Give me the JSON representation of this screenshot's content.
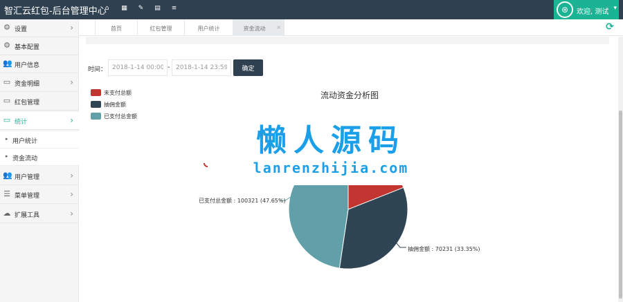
{
  "header": {
    "title": "智汇云红包-后台管理中心",
    "quick_buttons": [
      {
        "icon": "home-icon",
        "glyph": "⌂",
        "color": "#f8ac59"
      },
      {
        "icon": "grid-icon",
        "glyph": "▦",
        "color": "#1ab394"
      },
      {
        "icon": "edit-icon",
        "glyph": "✎",
        "color": "#23c6c8"
      },
      {
        "icon": "document-icon",
        "glyph": "▤",
        "color": "#ed5565"
      },
      {
        "icon": "list-icon",
        "glyph": "≡",
        "color": "#c2c2c2"
      }
    ],
    "welcome": "欢迎, 测试"
  },
  "sidebar": {
    "items": [
      {
        "label": "设置",
        "icon": "gears-icon",
        "glyph": "⚙",
        "chevron": "›"
      },
      {
        "label": "基本配置",
        "icon": "gears-icon",
        "glyph": "⚙",
        "chevron": ""
      },
      {
        "label": "用户信息",
        "icon": "users-icon",
        "glyph": "👥",
        "chevron": ""
      },
      {
        "label": "资金明细",
        "icon": "monitor-icon",
        "glyph": "▭",
        "chevron": "›"
      },
      {
        "label": "红包管理",
        "icon": "monitor-icon",
        "glyph": "▭",
        "chevron": ""
      },
      {
        "label": "统计",
        "icon": "monitor-icon",
        "glyph": "▭",
        "chevron": "›"
      },
      {
        "label": "用户管理",
        "icon": "users-icon",
        "glyph": "👥",
        "chevron": "›"
      },
      {
        "label": "菜单管理",
        "icon": "list-icon",
        "glyph": "☰",
        "chevron": "›"
      },
      {
        "label": "扩展工具",
        "icon": "cloud-icon",
        "glyph": "☁",
        "chevron": "›"
      }
    ],
    "sub_items": [
      {
        "label": "用户统计"
      },
      {
        "label": "资金流动"
      }
    ]
  },
  "tabs": [
    {
      "label": "首页"
    },
    {
      "label": "红包管理"
    },
    {
      "label": "用户统计"
    },
    {
      "label": "资金流动",
      "close": "×"
    }
  ],
  "filter": {
    "time_label": "时间：",
    "start": "2018-1-14 00:00",
    "separator": "-",
    "end": "2018-1-14 23:59",
    "confirm": "确定"
  },
  "chart_data": {
    "type": "pie",
    "title": "流动资金分析图",
    "legend_position": "top-left",
    "slices": [
      {
        "name": "未支付总额",
        "color": "#c23531",
        "percent": 19.0
      },
      {
        "name": "抽佣金额",
        "value": 70231,
        "percent": 33.35,
        "color": "#2f4554",
        "label": "抽佣金额 : 70231 (33.35%)"
      },
      {
        "name": "已支付总金额",
        "value": 100321,
        "percent": 47.65,
        "color": "#61a0a8",
        "label": "已支付总金额 : 100321 (47.65%)"
      }
    ]
  },
  "watermark": {
    "main": "懒人源码",
    "sub": "lanrenzhijia.com"
  },
  "colors": {
    "accent": "#1ab394",
    "header_bg": "#2f4050"
  }
}
